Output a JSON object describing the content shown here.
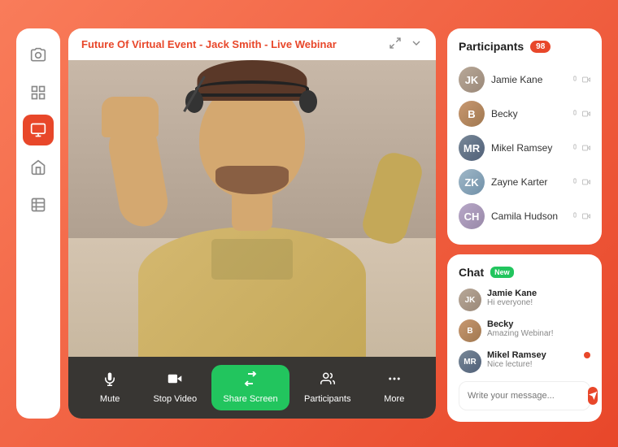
{
  "app": {
    "title": "Future Of Virtual Event - Jack Smith - Live Webinar"
  },
  "sidebar": {
    "items": [
      {
        "id": "camera",
        "icon": "📷",
        "label": "Camera",
        "active": false
      },
      {
        "id": "layout",
        "icon": "⊞",
        "label": "Layout",
        "active": false
      },
      {
        "id": "monitor",
        "icon": "🖥",
        "label": "Monitor",
        "active": true
      },
      {
        "id": "home",
        "icon": "⌂",
        "label": "Home",
        "active": false
      },
      {
        "id": "table",
        "icon": "▤",
        "label": "Table",
        "active": false
      }
    ]
  },
  "controls": [
    {
      "id": "mute",
      "icon": "🎤",
      "label": "Mute",
      "active": false
    },
    {
      "id": "stop-video",
      "icon": "📹",
      "label": "Stop Video",
      "active": false
    },
    {
      "id": "share-screen",
      "icon": "↑",
      "label": "Share Screen",
      "active": true
    },
    {
      "id": "participants",
      "icon": "👥",
      "label": "Participants",
      "active": false
    },
    {
      "id": "more",
      "icon": "···",
      "label": "More",
      "active": false
    }
  ],
  "participants": {
    "title": "Participants",
    "count": "98",
    "list": [
      {
        "name": "Jamie Kane",
        "initials": "JK",
        "avatar_class": "av-1"
      },
      {
        "name": "Becky",
        "initials": "B",
        "avatar_class": "av-2"
      },
      {
        "name": "Mikel Ramsey",
        "initials": "MR",
        "avatar_class": "av-3"
      },
      {
        "name": "Zayne Karter",
        "initials": "ZK",
        "avatar_class": "av-4"
      },
      {
        "name": "Camila Hudson",
        "initials": "CH",
        "avatar_class": "av-5"
      }
    ]
  },
  "chat": {
    "title": "Chat",
    "badge": "New",
    "messages": [
      {
        "name": "Jamie Kane",
        "text": "Hi everyone!",
        "initials": "JK",
        "avatar_class": "av-1",
        "has_dot": false
      },
      {
        "name": "Becky",
        "text": "Amazing Webinar!",
        "initials": "B",
        "avatar_class": "av-2",
        "has_dot": false
      },
      {
        "name": "Mikel Ramsey",
        "text": "Nice lecture!",
        "initials": "MR",
        "avatar_class": "av-3",
        "has_dot": true
      }
    ],
    "input_placeholder": "Write your message..."
  }
}
